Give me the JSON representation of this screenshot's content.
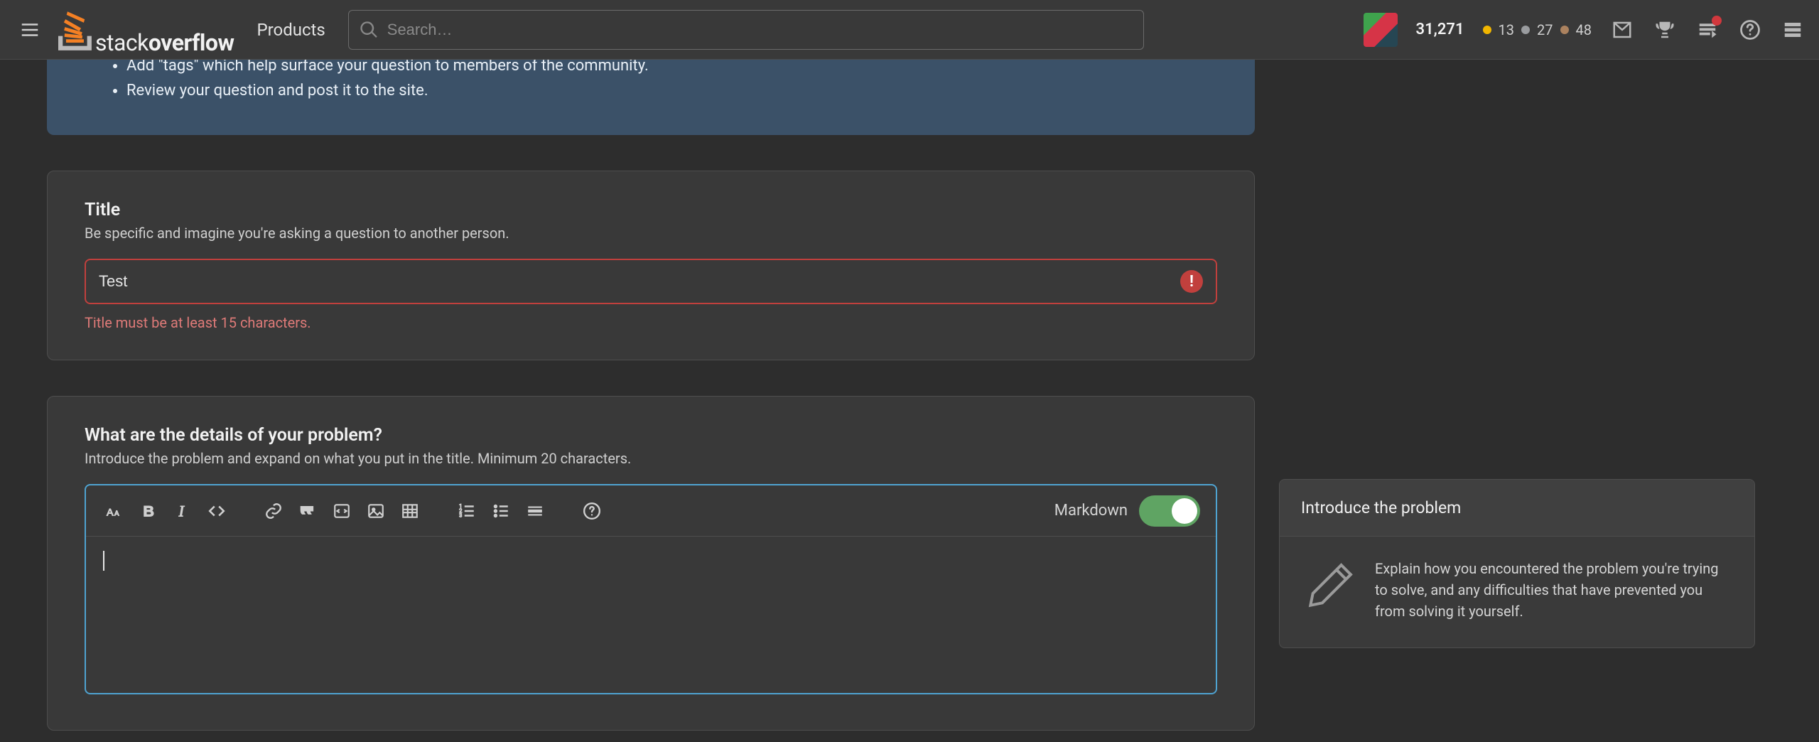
{
  "colors": {
    "error": "#c1403d",
    "focus": "#4fa3d1",
    "toggle_on": "#5fa463",
    "notice_bg": "#3b5168"
  },
  "topbar": {
    "logo_text_1": "stack",
    "logo_text_2": "overflow",
    "products_label": "Products",
    "search_placeholder": "Search…",
    "reputation": "31,271",
    "badges": {
      "gold": "13",
      "silver": "27",
      "bronze": "48"
    }
  },
  "notice": {
    "items": [
      "Add \"tags\" which help surface your question to members of the community.",
      "Review your question and post it to the site."
    ]
  },
  "title_card": {
    "heading": "Title",
    "sub": "Be specific and imagine you're asking a question to another person.",
    "value": "Test",
    "error": "Title must be at least 15 characters."
  },
  "details_card": {
    "heading": "What are the details of your problem?",
    "sub": "Introduce the problem and expand on what you put in the title. Minimum 20 characters.",
    "markdown_label": "Markdown",
    "markdown_on": true,
    "body_value": ""
  },
  "side_help": {
    "title": "Introduce the problem",
    "body": "Explain how you encountered the problem you're trying to solve, and any difficulties that have prevented you from solving it yourself."
  }
}
